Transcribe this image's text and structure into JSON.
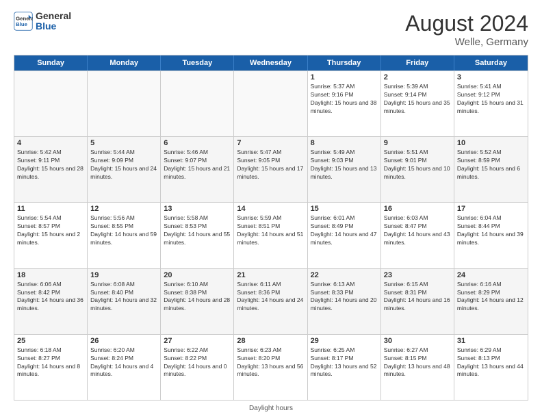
{
  "header": {
    "logo_line1": "General",
    "logo_line2": "Blue",
    "month_title": "August 2024",
    "location": "Welle, Germany"
  },
  "days_of_week": [
    "Sunday",
    "Monday",
    "Tuesday",
    "Wednesday",
    "Thursday",
    "Friday",
    "Saturday"
  ],
  "footer_text": "Daylight hours",
  "rows": [
    [
      {
        "day": "",
        "empty": true
      },
      {
        "day": "",
        "empty": true
      },
      {
        "day": "",
        "empty": true
      },
      {
        "day": "",
        "empty": true
      },
      {
        "day": "1",
        "sunrise": "Sunrise: 5:37 AM",
        "sunset": "Sunset: 9:16 PM",
        "daylight": "Daylight: 15 hours and 38 minutes."
      },
      {
        "day": "2",
        "sunrise": "Sunrise: 5:39 AM",
        "sunset": "Sunset: 9:14 PM",
        "daylight": "Daylight: 15 hours and 35 minutes."
      },
      {
        "day": "3",
        "sunrise": "Sunrise: 5:41 AM",
        "sunset": "Sunset: 9:12 PM",
        "daylight": "Daylight: 15 hours and 31 minutes."
      }
    ],
    [
      {
        "day": "4",
        "sunrise": "Sunrise: 5:42 AM",
        "sunset": "Sunset: 9:11 PM",
        "daylight": "Daylight: 15 hours and 28 minutes."
      },
      {
        "day": "5",
        "sunrise": "Sunrise: 5:44 AM",
        "sunset": "Sunset: 9:09 PM",
        "daylight": "Daylight: 15 hours and 24 minutes."
      },
      {
        "day": "6",
        "sunrise": "Sunrise: 5:46 AM",
        "sunset": "Sunset: 9:07 PM",
        "daylight": "Daylight: 15 hours and 21 minutes."
      },
      {
        "day": "7",
        "sunrise": "Sunrise: 5:47 AM",
        "sunset": "Sunset: 9:05 PM",
        "daylight": "Daylight: 15 hours and 17 minutes."
      },
      {
        "day": "8",
        "sunrise": "Sunrise: 5:49 AM",
        "sunset": "Sunset: 9:03 PM",
        "daylight": "Daylight: 15 hours and 13 minutes."
      },
      {
        "day": "9",
        "sunrise": "Sunrise: 5:51 AM",
        "sunset": "Sunset: 9:01 PM",
        "daylight": "Daylight: 15 hours and 10 minutes."
      },
      {
        "day": "10",
        "sunrise": "Sunrise: 5:52 AM",
        "sunset": "Sunset: 8:59 PM",
        "daylight": "Daylight: 15 hours and 6 minutes."
      }
    ],
    [
      {
        "day": "11",
        "sunrise": "Sunrise: 5:54 AM",
        "sunset": "Sunset: 8:57 PM",
        "daylight": "Daylight: 15 hours and 2 minutes."
      },
      {
        "day": "12",
        "sunrise": "Sunrise: 5:56 AM",
        "sunset": "Sunset: 8:55 PM",
        "daylight": "Daylight: 14 hours and 59 minutes."
      },
      {
        "day": "13",
        "sunrise": "Sunrise: 5:58 AM",
        "sunset": "Sunset: 8:53 PM",
        "daylight": "Daylight: 14 hours and 55 minutes."
      },
      {
        "day": "14",
        "sunrise": "Sunrise: 5:59 AM",
        "sunset": "Sunset: 8:51 PM",
        "daylight": "Daylight: 14 hours and 51 minutes."
      },
      {
        "day": "15",
        "sunrise": "Sunrise: 6:01 AM",
        "sunset": "Sunset: 8:49 PM",
        "daylight": "Daylight: 14 hours and 47 minutes."
      },
      {
        "day": "16",
        "sunrise": "Sunrise: 6:03 AM",
        "sunset": "Sunset: 8:47 PM",
        "daylight": "Daylight: 14 hours and 43 minutes."
      },
      {
        "day": "17",
        "sunrise": "Sunrise: 6:04 AM",
        "sunset": "Sunset: 8:44 PM",
        "daylight": "Daylight: 14 hours and 39 minutes."
      }
    ],
    [
      {
        "day": "18",
        "sunrise": "Sunrise: 6:06 AM",
        "sunset": "Sunset: 8:42 PM",
        "daylight": "Daylight: 14 hours and 36 minutes."
      },
      {
        "day": "19",
        "sunrise": "Sunrise: 6:08 AM",
        "sunset": "Sunset: 8:40 PM",
        "daylight": "Daylight: 14 hours and 32 minutes."
      },
      {
        "day": "20",
        "sunrise": "Sunrise: 6:10 AM",
        "sunset": "Sunset: 8:38 PM",
        "daylight": "Daylight: 14 hours and 28 minutes."
      },
      {
        "day": "21",
        "sunrise": "Sunrise: 6:11 AM",
        "sunset": "Sunset: 8:36 PM",
        "daylight": "Daylight: 14 hours and 24 minutes."
      },
      {
        "day": "22",
        "sunrise": "Sunrise: 6:13 AM",
        "sunset": "Sunset: 8:33 PM",
        "daylight": "Daylight: 14 hours and 20 minutes."
      },
      {
        "day": "23",
        "sunrise": "Sunrise: 6:15 AM",
        "sunset": "Sunset: 8:31 PM",
        "daylight": "Daylight: 14 hours and 16 minutes."
      },
      {
        "day": "24",
        "sunrise": "Sunrise: 6:16 AM",
        "sunset": "Sunset: 8:29 PM",
        "daylight": "Daylight: 14 hours and 12 minutes."
      }
    ],
    [
      {
        "day": "25",
        "sunrise": "Sunrise: 6:18 AM",
        "sunset": "Sunset: 8:27 PM",
        "daylight": "Daylight: 14 hours and 8 minutes."
      },
      {
        "day": "26",
        "sunrise": "Sunrise: 6:20 AM",
        "sunset": "Sunset: 8:24 PM",
        "daylight": "Daylight: 14 hours and 4 minutes."
      },
      {
        "day": "27",
        "sunrise": "Sunrise: 6:22 AM",
        "sunset": "Sunset: 8:22 PM",
        "daylight": "Daylight: 14 hours and 0 minutes."
      },
      {
        "day": "28",
        "sunrise": "Sunrise: 6:23 AM",
        "sunset": "Sunset: 8:20 PM",
        "daylight": "Daylight: 13 hours and 56 minutes."
      },
      {
        "day": "29",
        "sunrise": "Sunrise: 6:25 AM",
        "sunset": "Sunset: 8:17 PM",
        "daylight": "Daylight: 13 hours and 52 minutes."
      },
      {
        "day": "30",
        "sunrise": "Sunrise: 6:27 AM",
        "sunset": "Sunset: 8:15 PM",
        "daylight": "Daylight: 13 hours and 48 minutes."
      },
      {
        "day": "31",
        "sunrise": "Sunrise: 6:29 AM",
        "sunset": "Sunset: 8:13 PM",
        "daylight": "Daylight: 13 hours and 44 minutes."
      }
    ]
  ]
}
